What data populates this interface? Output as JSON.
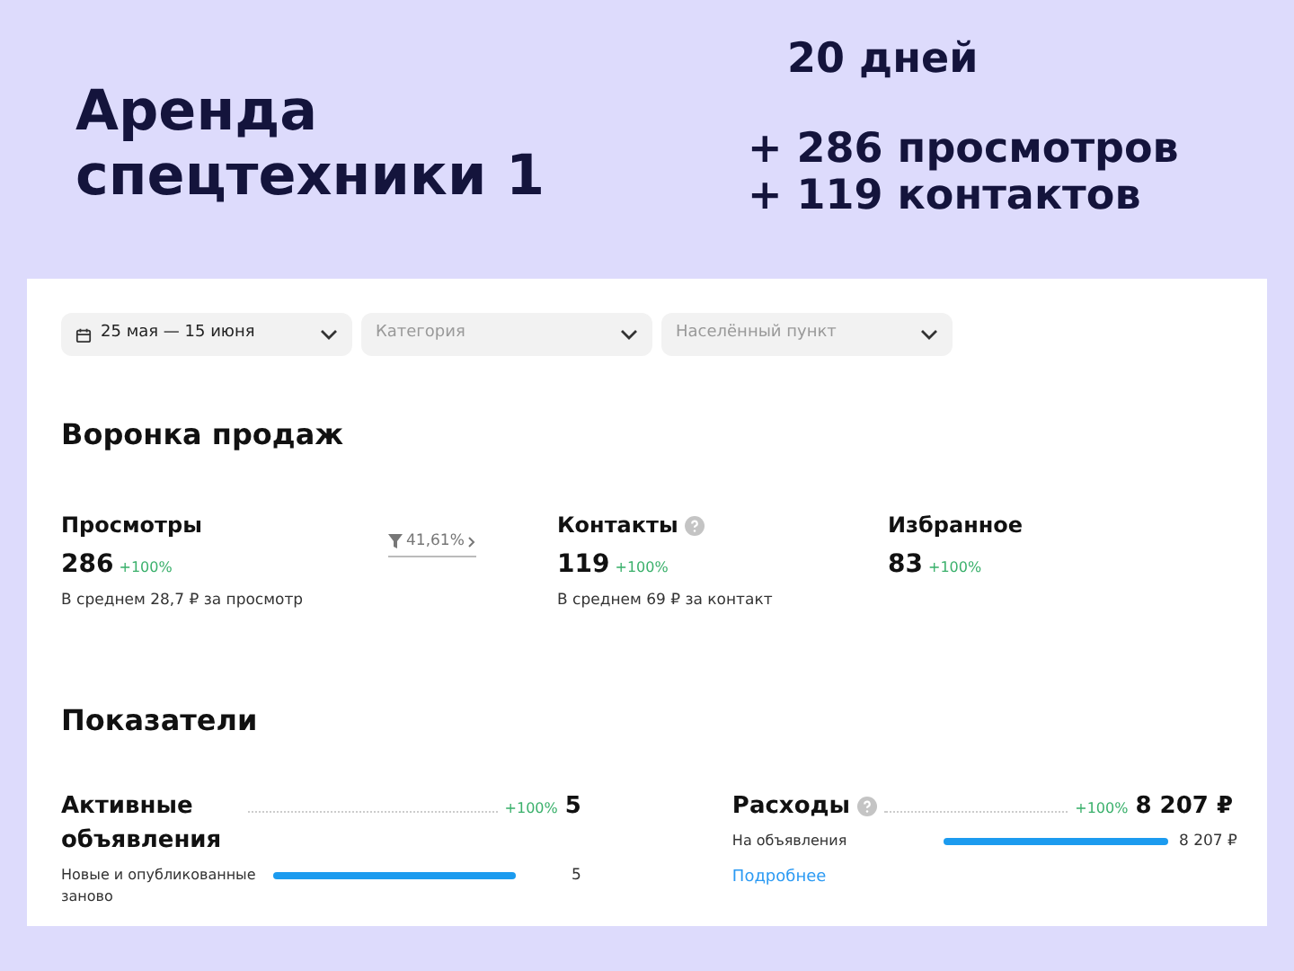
{
  "banner": {
    "title": "Аренда спецтехники 1",
    "period": "20 дней",
    "gains": [
      "+ 286 просмотров",
      "+ 119 контактов"
    ]
  },
  "filters": [
    {
      "kind": "date",
      "value": "25 мая — 15 июня"
    },
    {
      "kind": "select",
      "placeholder": "Категория"
    },
    {
      "kind": "select",
      "placeholder": "Населённый пункт"
    }
  ],
  "funnel": {
    "title": "Воронка продаж",
    "conversion": "41,61%",
    "metrics": [
      {
        "label": "Просмотры",
        "help": false,
        "value": "286",
        "change": "+100%",
        "note": "В среднем 28,7 ₽ за просмотр"
      },
      {
        "label": "Контакты",
        "help": true,
        "value": "119",
        "change": "+100%",
        "note": "В среднем 69 ₽ за контакт"
      },
      {
        "label": "Избранное",
        "help": false,
        "value": "83",
        "change": "+100%"
      }
    ]
  },
  "indicators": {
    "title": "Показатели",
    "cards": [
      {
        "label": "Активные объявления",
        "help": false,
        "change": "+100%",
        "value": "5",
        "rows": [
          {
            "label": "Новые и опубликованные заново",
            "value": "5"
          }
        ]
      },
      {
        "label": "Расходы",
        "help": true,
        "change": "+100%",
        "value": "8 207 ₽",
        "rows": [
          {
            "label": "На объявления",
            "value": "8 207 ₽"
          }
        ],
        "link": "Подробнее"
      }
    ]
  }
}
